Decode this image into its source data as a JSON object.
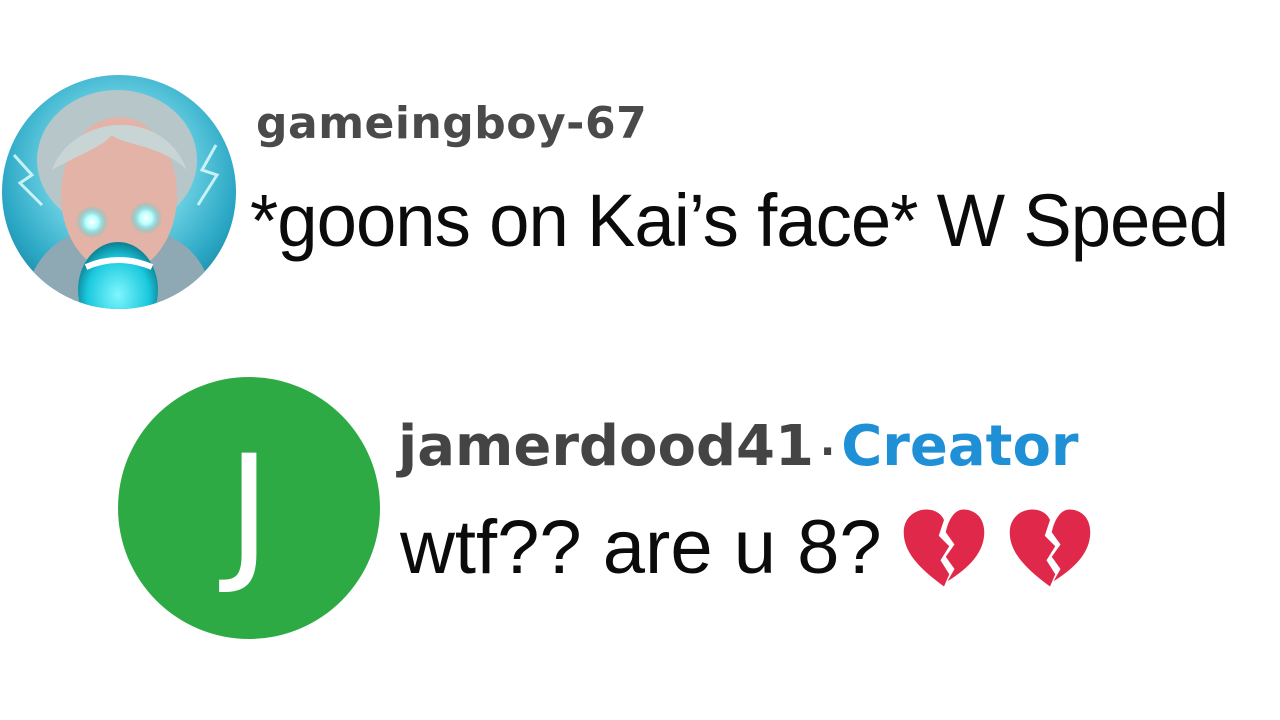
{
  "comments": [
    {
      "username": "gameingboy-67",
      "avatar_icon": "glowing-face-avatar-icon",
      "text": "*goons on Kai’s face* W Speed"
    },
    {
      "username": "jamerdood41",
      "separator": "·",
      "badge": "Creator",
      "avatar_letter": "J",
      "avatar_color": "#2eaa45",
      "text": "wtf?? are u 8?",
      "emojis": [
        "broken-heart-icon",
        "broken-heart-icon"
      ]
    }
  ],
  "colors": {
    "username": "#4a4a4a",
    "creator_badge": "#1f8fd6",
    "comment_text": "#0b0b0b",
    "heart": "#e0284a"
  }
}
